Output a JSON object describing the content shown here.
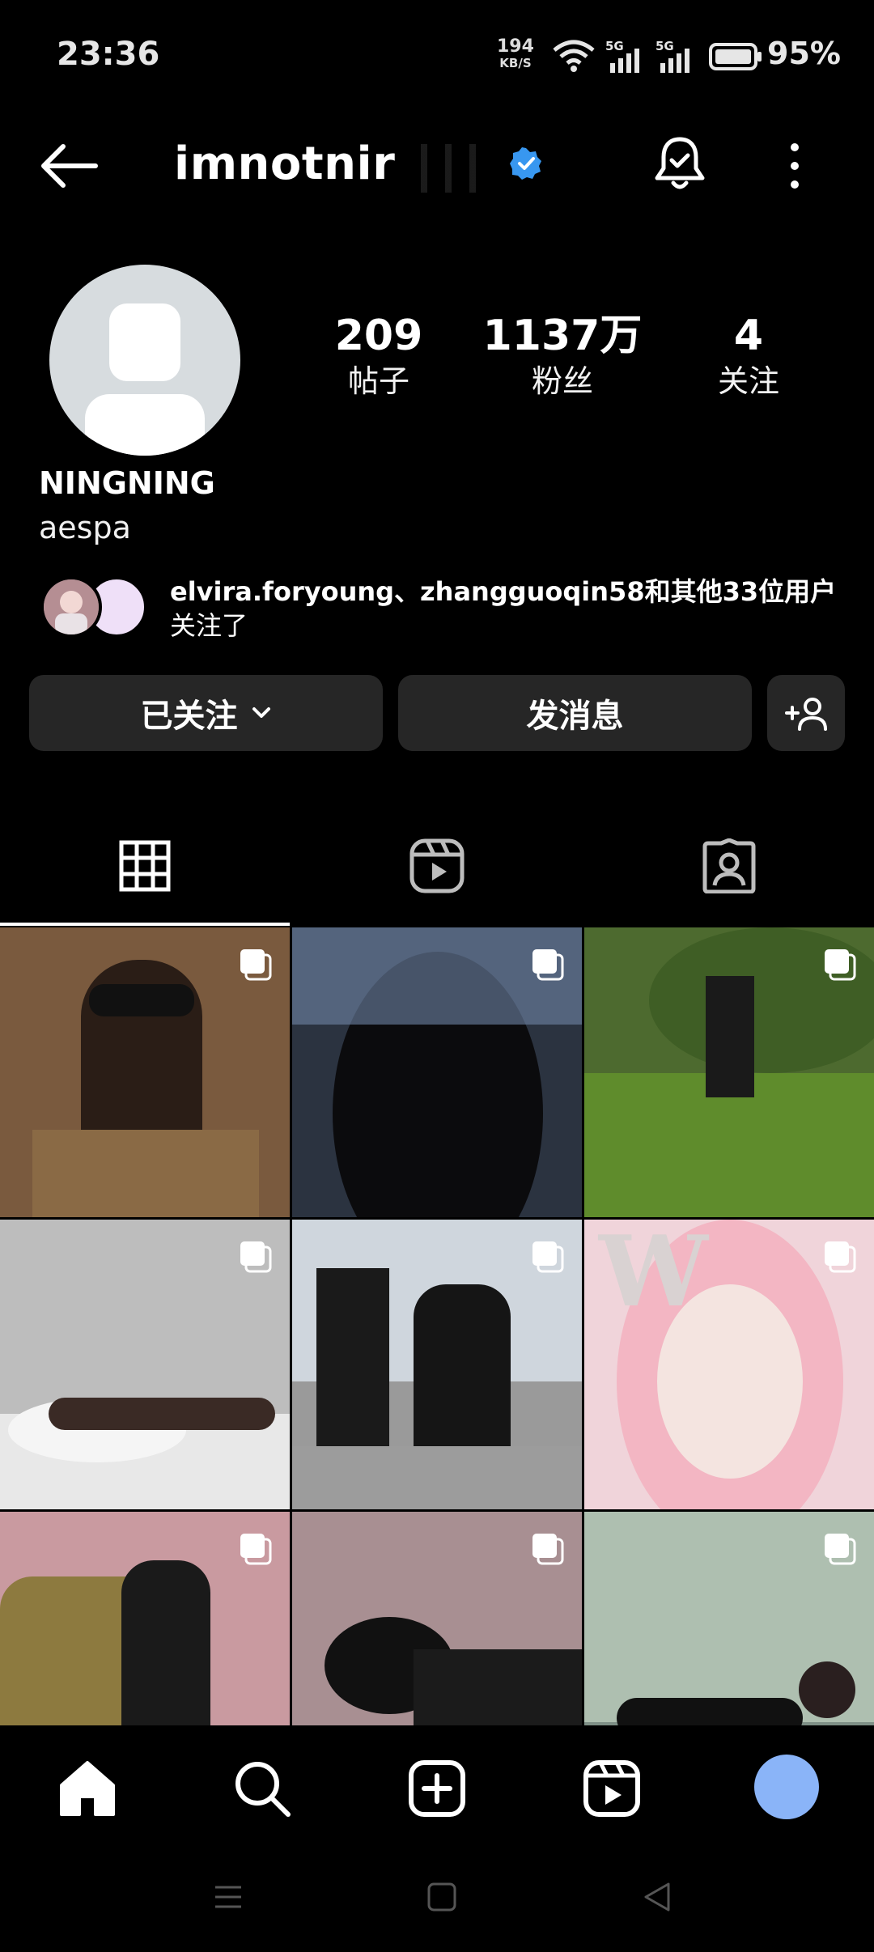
{
  "status_bar": {
    "time": "23:36",
    "net_speed_value": "194",
    "net_speed_unit": "KB/S",
    "battery": "95%",
    "signal1_label": "5G",
    "signal2_label": "5G"
  },
  "header": {
    "username": "imnotnir",
    "verified": true,
    "icons": [
      "back-arrow-icon",
      "verified-badge-icon",
      "notification-bell-icon",
      "more-vertical-icon"
    ]
  },
  "profile": {
    "stats": [
      {
        "value": "209",
        "label": "帖子"
      },
      {
        "value": "1137万",
        "label": "粉丝"
      },
      {
        "value": "4",
        "label": "关注"
      }
    ],
    "display_name": "NINGNING",
    "bio": "aespa",
    "followed_by": {
      "users": "elvira.foryoung、zhangguoqin58",
      "and_others": "和其他33位用户",
      "suffix": "关注了"
    }
  },
  "actions": {
    "following_label": "已关注",
    "message_label": "发消息",
    "add_friend_icon": "add-person-icon"
  },
  "tabs": [
    {
      "name": "posts-grid",
      "icon": "grid-icon",
      "active": true
    },
    {
      "name": "reels",
      "icon": "reels-icon",
      "active": false
    },
    {
      "name": "tagged",
      "icon": "tagged-person-icon",
      "active": false
    }
  ],
  "grid": {
    "cells": [
      {
        "bg": "#7a5a3e"
      },
      {
        "bg": "#2b3340"
      },
      {
        "bg": "#4d6a2f"
      },
      {
        "bg": "#bdbdbd"
      },
      {
        "bg": "#9a9a9a"
      },
      {
        "bg": "#f0d4da"
      },
      {
        "bg": "#c99aa0"
      },
      {
        "bg": "#8e7a7c"
      },
      {
        "bg": "#9fb3a6"
      }
    ],
    "watermark_letter": "W"
  },
  "bottom_nav": [
    "home-icon",
    "search-icon",
    "create-icon",
    "reels-icon",
    "profile-avatar"
  ],
  "colors": {
    "background": "#000000",
    "button_bg": "#262626",
    "verified_blue": "#3897f0",
    "profile_avatar": "#8ab4f8"
  }
}
